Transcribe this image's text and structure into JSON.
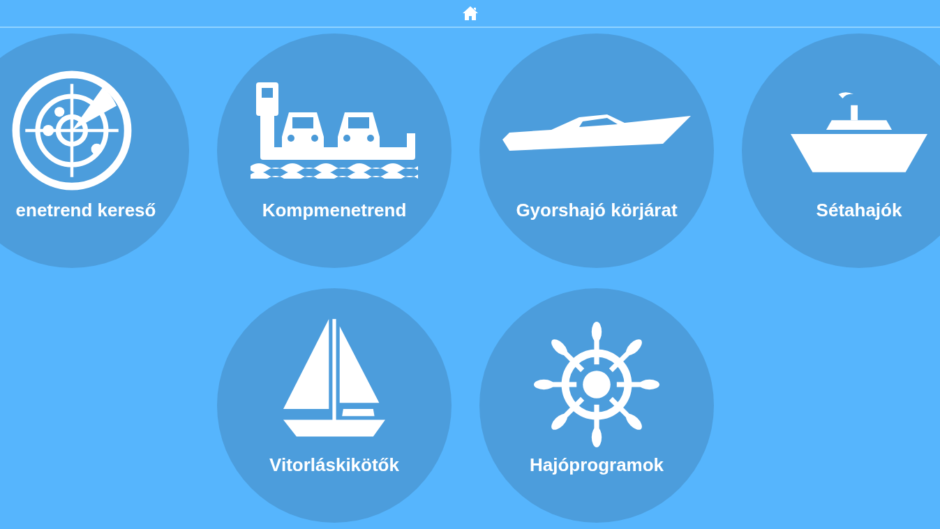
{
  "menu_rows": [
    {
      "items": [
        {
          "kind": "radar",
          "label": "enetrend kereső"
        },
        {
          "kind": "ferry",
          "label": "Kompmenetrend"
        },
        {
          "kind": "speedboat",
          "label": "Gyorshajó körjárat"
        },
        {
          "kind": "ship",
          "label": "Sétahajók"
        }
      ]
    },
    {
      "items": [
        {
          "kind": "sailboat",
          "label": "Vitorláskikötők"
        },
        {
          "kind": "wheel",
          "label": "Hajóprogramok"
        }
      ]
    }
  ]
}
